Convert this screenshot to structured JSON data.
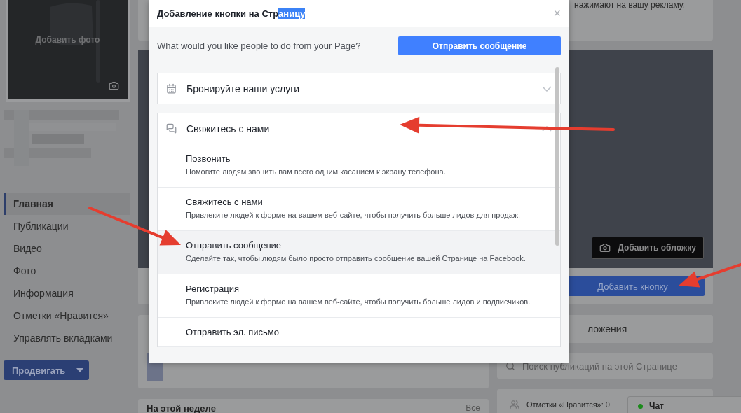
{
  "sidebar": {
    "photo_label": "Добавить фото",
    "nav": [
      {
        "label": "Главная",
        "selected": true
      },
      {
        "label": "Публикации",
        "selected": false
      },
      {
        "label": "Видео",
        "selected": false
      },
      {
        "label": "Фото",
        "selected": false
      },
      {
        "label": "Информация",
        "selected": false
      },
      {
        "label": "Отметки «Нравится»",
        "selected": false
      },
      {
        "label": "Управлять вкладками",
        "selected": false
      }
    ],
    "promote_button": "Продвигать"
  },
  "top_card": {
    "text": "нажимают на вашу рекламу."
  },
  "cover": {
    "add_cover_button": "Добавить обложку",
    "add_button": "Добавить кнопку"
  },
  "this_week": {
    "title": "На этой неделе",
    "link": "Все"
  },
  "apps_card": {
    "title": "ложения"
  },
  "search": {
    "placeholder": "Поиск публикаций на этой Странице"
  },
  "likes": {
    "text": "Отметки «Нравится»: 0"
  },
  "chat": {
    "label": "Чат",
    "online": true
  },
  "modal": {
    "title": "Добавление кнопки на Стр",
    "title_selected": "аницу",
    "close": "×",
    "prompt": "What would you like people to do from your Page?",
    "preview_button": "Отправить сообщение",
    "sections": [
      {
        "label": "Бронируйте наши услуги",
        "expanded": false
      },
      {
        "label": "Свяжитесь с нами",
        "expanded": true,
        "options": [
          {
            "title": "Позвонить",
            "description": "Помогите людям звонить вам всего одним касанием к экрану телефона.",
            "selected": false
          },
          {
            "title": "Свяжитесь с нами",
            "description": "Привлеките людей к форме на вашем веб-сайте, чтобы получить больше лидов для продаж.",
            "selected": false
          },
          {
            "title": "Отправить сообщение",
            "description": "Сделайте так, чтобы людям было просто отправить сообщение вашей Странице на Facebook.",
            "selected": true
          },
          {
            "title": "Регистрация",
            "description": "Привлеките людей к форме на вашем веб-сайте, чтобы получить больше лидов и подписчиков.",
            "selected": false
          },
          {
            "title": "Отправить эл. письмо",
            "selected": false
          }
        ]
      }
    ]
  }
}
